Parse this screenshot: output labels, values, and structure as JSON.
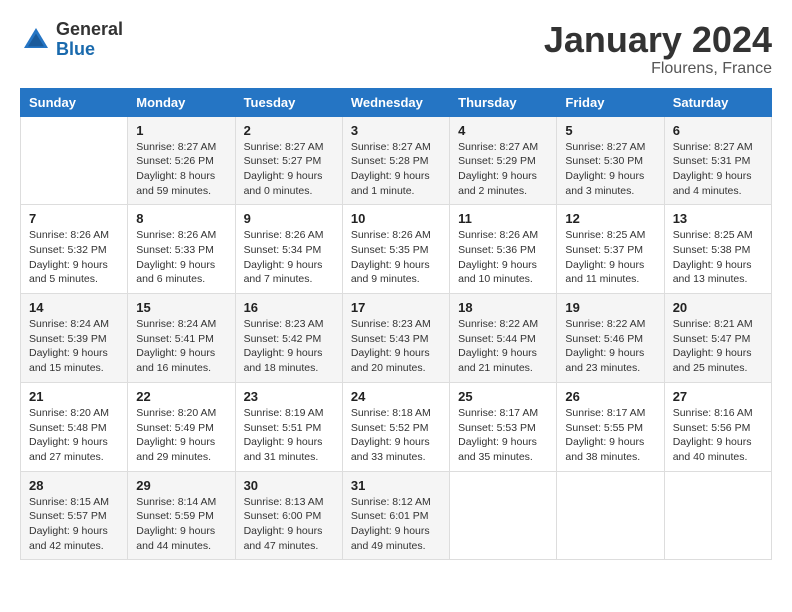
{
  "header": {
    "logo_general": "General",
    "logo_blue": "Blue",
    "month": "January 2024",
    "location": "Flourens, France"
  },
  "days_of_week": [
    "Sunday",
    "Monday",
    "Tuesday",
    "Wednesday",
    "Thursday",
    "Friday",
    "Saturday"
  ],
  "weeks": [
    [
      {
        "day": "",
        "info": ""
      },
      {
        "day": "1",
        "info": "Sunrise: 8:27 AM\nSunset: 5:26 PM\nDaylight: 8 hours\nand 59 minutes."
      },
      {
        "day": "2",
        "info": "Sunrise: 8:27 AM\nSunset: 5:27 PM\nDaylight: 9 hours\nand 0 minutes."
      },
      {
        "day": "3",
        "info": "Sunrise: 8:27 AM\nSunset: 5:28 PM\nDaylight: 9 hours\nand 1 minute."
      },
      {
        "day": "4",
        "info": "Sunrise: 8:27 AM\nSunset: 5:29 PM\nDaylight: 9 hours\nand 2 minutes."
      },
      {
        "day": "5",
        "info": "Sunrise: 8:27 AM\nSunset: 5:30 PM\nDaylight: 9 hours\nand 3 minutes."
      },
      {
        "day": "6",
        "info": "Sunrise: 8:27 AM\nSunset: 5:31 PM\nDaylight: 9 hours\nand 4 minutes."
      }
    ],
    [
      {
        "day": "7",
        "info": "Sunrise: 8:26 AM\nSunset: 5:32 PM\nDaylight: 9 hours\nand 5 minutes."
      },
      {
        "day": "8",
        "info": "Sunrise: 8:26 AM\nSunset: 5:33 PM\nDaylight: 9 hours\nand 6 minutes."
      },
      {
        "day": "9",
        "info": "Sunrise: 8:26 AM\nSunset: 5:34 PM\nDaylight: 9 hours\nand 7 minutes."
      },
      {
        "day": "10",
        "info": "Sunrise: 8:26 AM\nSunset: 5:35 PM\nDaylight: 9 hours\nand 9 minutes."
      },
      {
        "day": "11",
        "info": "Sunrise: 8:26 AM\nSunset: 5:36 PM\nDaylight: 9 hours\nand 10 minutes."
      },
      {
        "day": "12",
        "info": "Sunrise: 8:25 AM\nSunset: 5:37 PM\nDaylight: 9 hours\nand 11 minutes."
      },
      {
        "day": "13",
        "info": "Sunrise: 8:25 AM\nSunset: 5:38 PM\nDaylight: 9 hours\nand 13 minutes."
      }
    ],
    [
      {
        "day": "14",
        "info": "Sunrise: 8:24 AM\nSunset: 5:39 PM\nDaylight: 9 hours\nand 15 minutes."
      },
      {
        "day": "15",
        "info": "Sunrise: 8:24 AM\nSunset: 5:41 PM\nDaylight: 9 hours\nand 16 minutes."
      },
      {
        "day": "16",
        "info": "Sunrise: 8:23 AM\nSunset: 5:42 PM\nDaylight: 9 hours\nand 18 minutes."
      },
      {
        "day": "17",
        "info": "Sunrise: 8:23 AM\nSunset: 5:43 PM\nDaylight: 9 hours\nand 20 minutes."
      },
      {
        "day": "18",
        "info": "Sunrise: 8:22 AM\nSunset: 5:44 PM\nDaylight: 9 hours\nand 21 minutes."
      },
      {
        "day": "19",
        "info": "Sunrise: 8:22 AM\nSunset: 5:46 PM\nDaylight: 9 hours\nand 23 minutes."
      },
      {
        "day": "20",
        "info": "Sunrise: 8:21 AM\nSunset: 5:47 PM\nDaylight: 9 hours\nand 25 minutes."
      }
    ],
    [
      {
        "day": "21",
        "info": "Sunrise: 8:20 AM\nSunset: 5:48 PM\nDaylight: 9 hours\nand 27 minutes."
      },
      {
        "day": "22",
        "info": "Sunrise: 8:20 AM\nSunset: 5:49 PM\nDaylight: 9 hours\nand 29 minutes."
      },
      {
        "day": "23",
        "info": "Sunrise: 8:19 AM\nSunset: 5:51 PM\nDaylight: 9 hours\nand 31 minutes."
      },
      {
        "day": "24",
        "info": "Sunrise: 8:18 AM\nSunset: 5:52 PM\nDaylight: 9 hours\nand 33 minutes."
      },
      {
        "day": "25",
        "info": "Sunrise: 8:17 AM\nSunset: 5:53 PM\nDaylight: 9 hours\nand 35 minutes."
      },
      {
        "day": "26",
        "info": "Sunrise: 8:17 AM\nSunset: 5:55 PM\nDaylight: 9 hours\nand 38 minutes."
      },
      {
        "day": "27",
        "info": "Sunrise: 8:16 AM\nSunset: 5:56 PM\nDaylight: 9 hours\nand 40 minutes."
      }
    ],
    [
      {
        "day": "28",
        "info": "Sunrise: 8:15 AM\nSunset: 5:57 PM\nDaylight: 9 hours\nand 42 minutes."
      },
      {
        "day": "29",
        "info": "Sunrise: 8:14 AM\nSunset: 5:59 PM\nDaylight: 9 hours\nand 44 minutes."
      },
      {
        "day": "30",
        "info": "Sunrise: 8:13 AM\nSunset: 6:00 PM\nDaylight: 9 hours\nand 47 minutes."
      },
      {
        "day": "31",
        "info": "Sunrise: 8:12 AM\nSunset: 6:01 PM\nDaylight: 9 hours\nand 49 minutes."
      },
      {
        "day": "",
        "info": ""
      },
      {
        "day": "",
        "info": ""
      },
      {
        "day": "",
        "info": ""
      }
    ]
  ]
}
